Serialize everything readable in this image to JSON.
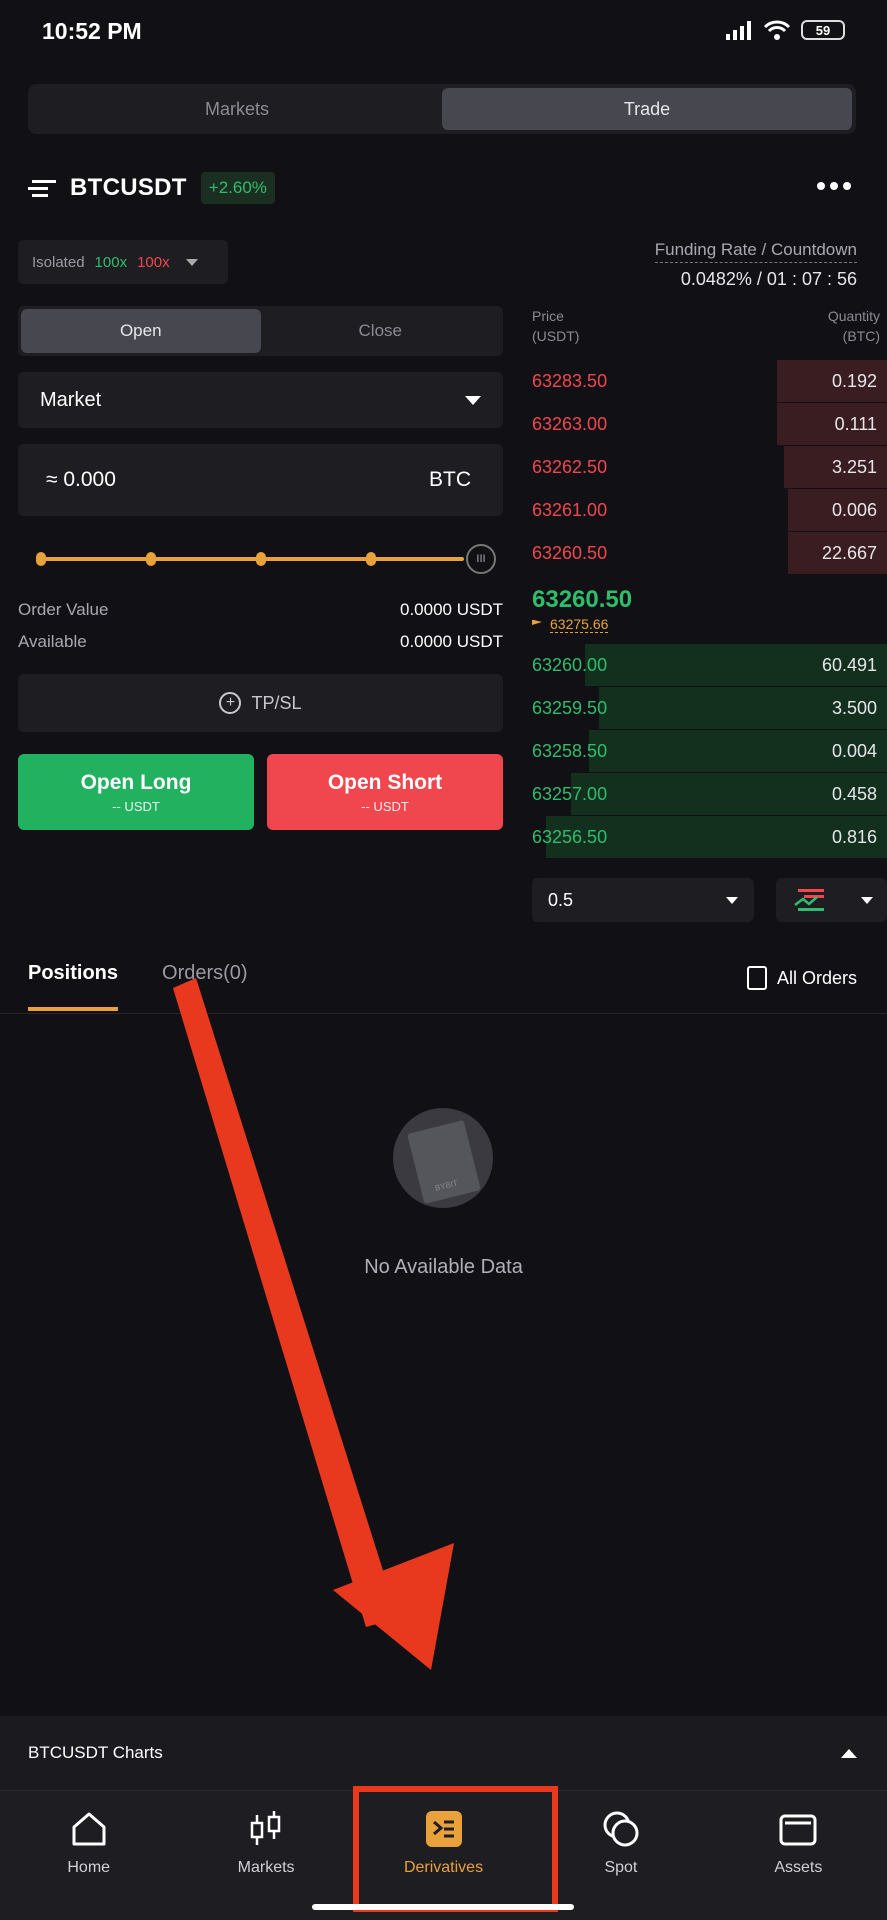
{
  "status_bar": {
    "time": "10:52 PM",
    "battery": "59"
  },
  "top_tabs": [
    {
      "label": "Markets"
    },
    {
      "label": "Trade"
    }
  ],
  "symbol": {
    "name": "BTCUSDT",
    "change": "+2.60%"
  },
  "margin": {
    "mode": "Isolated",
    "long_leverage": "100x",
    "short_leverage": "100x"
  },
  "funding": {
    "label": "Funding Rate / Countdown",
    "value": "0.0482% / 01 : 07 : 56"
  },
  "order_form": {
    "open_label": "Open",
    "close_label": "Close",
    "order_type": "Market",
    "qty_value": "≈ 0.000",
    "qty_unit": "BTC",
    "slider_level": 0,
    "order_value_label": "Order Value",
    "order_value": "0.0000 USDT",
    "available_label": "Available",
    "available_value": "0.0000 USDT",
    "tpsl_label": "TP/SL",
    "open_long_label": "Open Long",
    "open_long_sub": "-- USDT",
    "open_short_label": "Open Short",
    "open_short_sub": "-- USDT"
  },
  "orderbook": {
    "price_header": "Price",
    "price_unit": "(USDT)",
    "qty_header": "Quantity",
    "qty_unit": "(BTC)",
    "asks": [
      {
        "price": "63283.50",
        "qty": "0.192",
        "depth": 0.31
      },
      {
        "price": "63263.00",
        "qty": "0.111",
        "depth": 0.31
      },
      {
        "price": "63262.50",
        "qty": "3.251",
        "depth": 0.29
      },
      {
        "price": "63261.00",
        "qty": "0.006",
        "depth": 0.28
      },
      {
        "price": "63260.50",
        "qty": "22.667",
        "depth": 0.28
      }
    ],
    "last_price": "63260.50",
    "mark_price": "63275.66",
    "bids": [
      {
        "price": "63260.00",
        "qty": "60.491",
        "depth": 0.85
      },
      {
        "price": "63259.50",
        "qty": "3.500",
        "depth": 0.81
      },
      {
        "price": "63258.50",
        "qty": "0.004",
        "depth": 0.84
      },
      {
        "price": "63257.00",
        "qty": "0.458",
        "depth": 0.89
      },
      {
        "price": "63256.50",
        "qty": "0.816",
        "depth": 0.96
      }
    ],
    "depth_value": "0.5"
  },
  "positions_tabs": {
    "positions": "Positions",
    "orders": "Orders(0)",
    "all_orders": "All Orders"
  },
  "empty_state": {
    "text": "No Available Data",
    "logo_text": "BYBIT"
  },
  "charts_bar": {
    "label": "BTCUSDT Charts"
  },
  "bottom_nav": [
    {
      "label": "Home",
      "icon": "home-icon"
    },
    {
      "label": "Markets",
      "icon": "candlestick-icon"
    },
    {
      "label": "Derivatives",
      "icon": "derivatives-icon"
    },
    {
      "label": "Spot",
      "icon": "spot-icon"
    },
    {
      "label": "Assets",
      "icon": "wallet-icon"
    }
  ],
  "colors": {
    "accent": "#e9a23b",
    "green": "#2ebd6b",
    "red": "#f0474f",
    "annotation": "#e8391e"
  }
}
